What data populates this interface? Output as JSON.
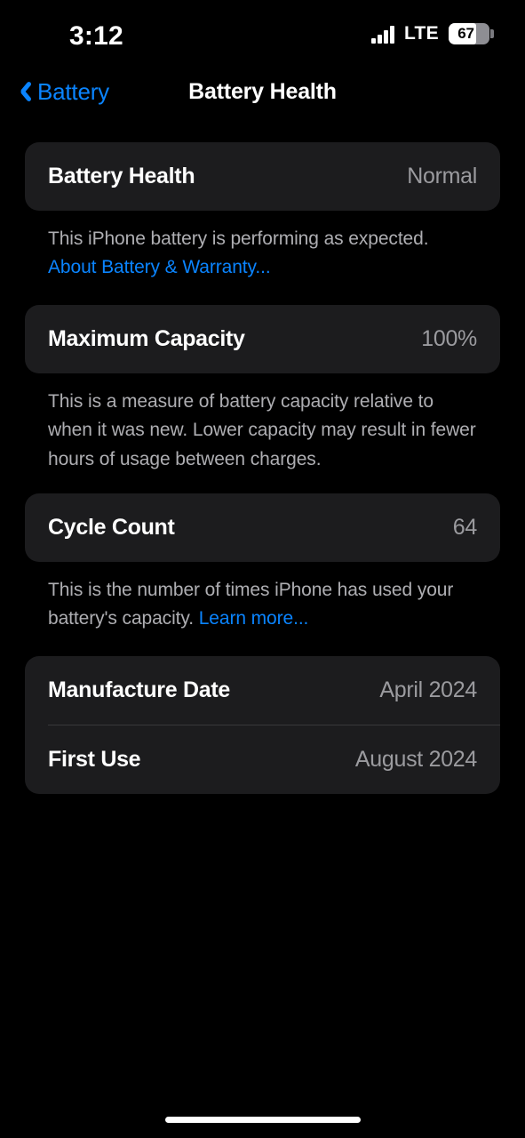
{
  "status_bar": {
    "time": "3:12",
    "carrier_network": "LTE",
    "battery_percent": "67",
    "battery_level": 67,
    "signal_bars": 4
  },
  "nav": {
    "back_label": "Battery",
    "title": "Battery Health"
  },
  "colors": {
    "background": "#000000",
    "card": "#1c1c1e",
    "accent_blue": "#0a84ff",
    "label": "#ffffff",
    "value": "#9b9b9f",
    "footnote": "#aeaeb2",
    "separator": "#38383a"
  },
  "sections": [
    {
      "rows": [
        {
          "label": "Battery Health",
          "value": "Normal"
        }
      ],
      "footnote": {
        "text": "This iPhone battery is performing as expected. ",
        "link": "About Battery & Warranty..."
      }
    },
    {
      "rows": [
        {
          "label": "Maximum Capacity",
          "value": "100%"
        }
      ],
      "footnote": {
        "text": "This is a measure of battery capacity relative to when it was new. Lower capacity may result in fewer hours of usage between charges.",
        "link": ""
      }
    },
    {
      "rows": [
        {
          "label": "Cycle Count",
          "value": "64"
        }
      ],
      "footnote": {
        "text": "This is the number of times iPhone has used your battery's capacity. ",
        "link": "Learn more..."
      }
    },
    {
      "rows": [
        {
          "label": "Manufacture Date",
          "value": "April 2024"
        },
        {
          "label": "First Use",
          "value": "August 2024"
        }
      ],
      "footnote": {
        "text": "",
        "link": ""
      }
    }
  ]
}
